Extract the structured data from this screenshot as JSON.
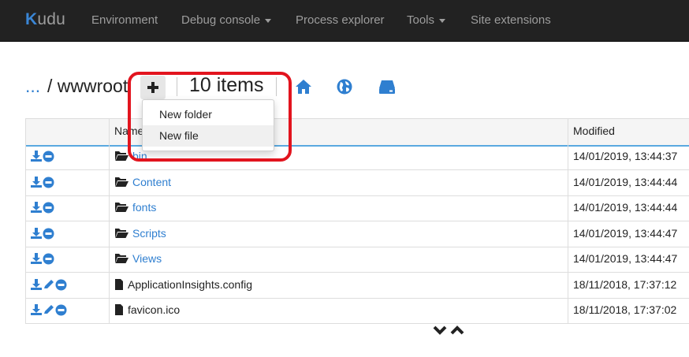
{
  "navbar": {
    "brand": "udu",
    "brand_initial": "K",
    "items": [
      {
        "label": "Environment"
      },
      {
        "label": "Debug console"
      },
      {
        "label": "Process explorer"
      },
      {
        "label": "Tools"
      },
      {
        "label": "Site extensions"
      }
    ]
  },
  "breadcrumb": {
    "parent": "...",
    "path": " / wwwroot"
  },
  "toolbar": {
    "item_count": "10 items",
    "icons": [
      "plus-icon",
      "home-icon",
      "globe-icon",
      "drive-icon"
    ]
  },
  "dropdown": {
    "items": [
      "New folder",
      "New file"
    ]
  },
  "table": {
    "headers": [
      "",
      "Name",
      "Modified"
    ],
    "rows": [
      {
        "name": "bin",
        "type": "folder",
        "modified": "14/01/2019, 13:44:37"
      },
      {
        "name": "Content",
        "type": "folder",
        "modified": "14/01/2019, 13:44:44"
      },
      {
        "name": "fonts",
        "type": "folder",
        "modified": "14/01/2019, 13:44:44"
      },
      {
        "name": "Scripts",
        "type": "folder",
        "modified": "14/01/2019, 13:44:47"
      },
      {
        "name": "Views",
        "type": "folder",
        "modified": "14/01/2019, 13:44:47"
      },
      {
        "name": "ApplicationInsights.config",
        "type": "file",
        "modified": "18/11/2018, 17:37:12"
      },
      {
        "name": "favicon.ico",
        "type": "file",
        "modified": "18/11/2018, 17:37:02"
      }
    ]
  },
  "colors": {
    "navbar_bg": "#222222",
    "link": "#2f7fd0",
    "highlight": "#e2141e",
    "header_border": "#5aa9e0"
  }
}
